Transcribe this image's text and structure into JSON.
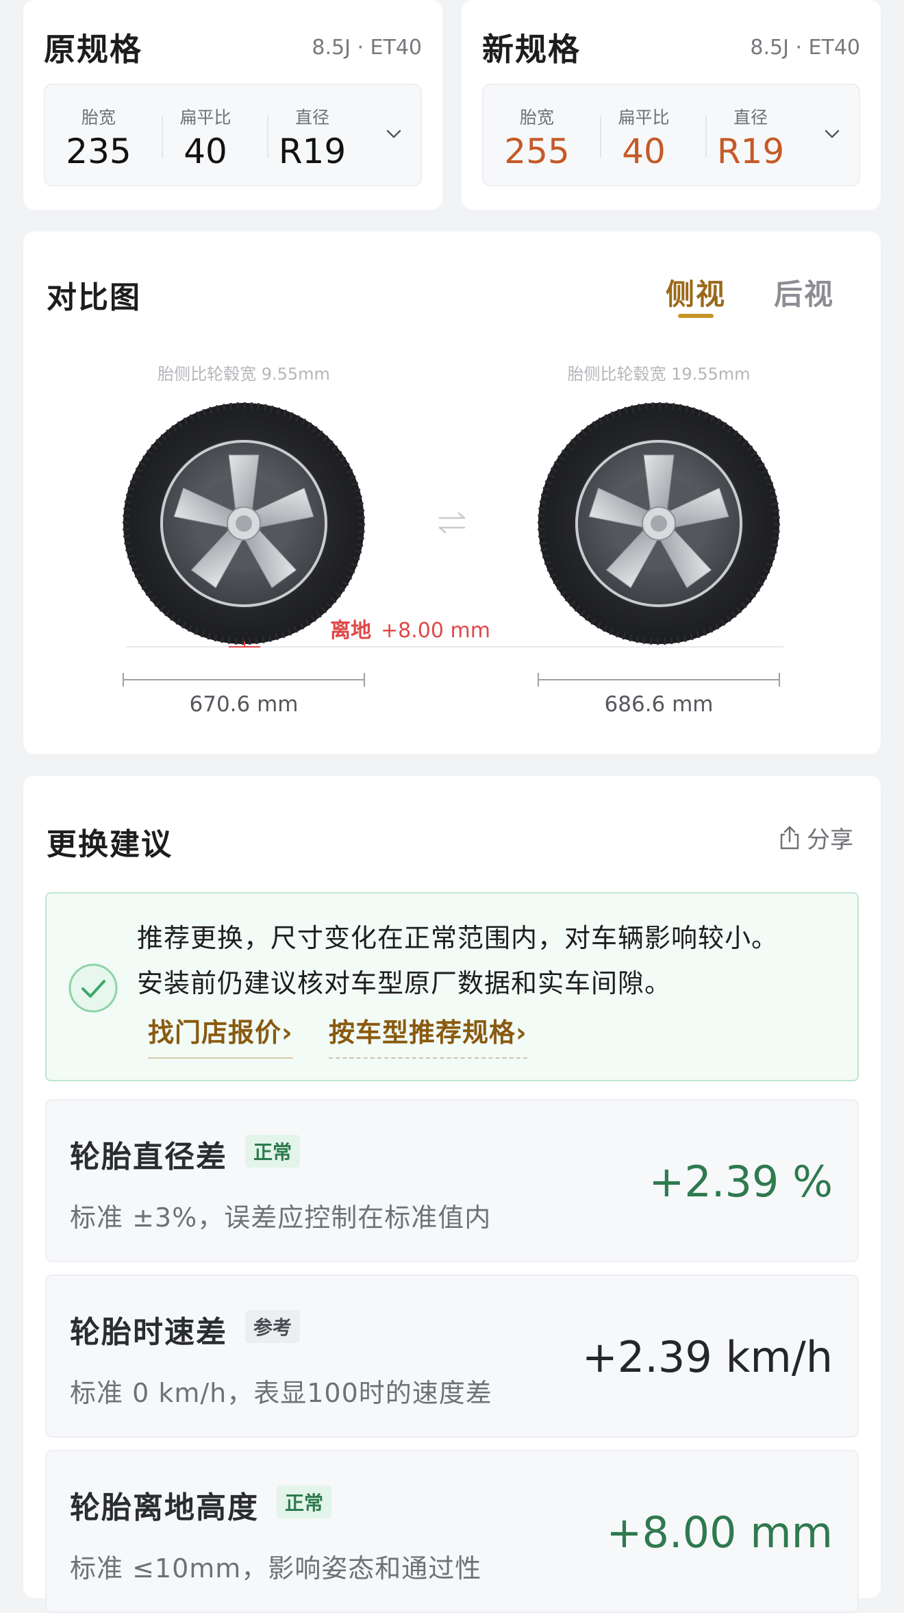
{
  "original": {
    "title": "原规格",
    "hub": "8.5J · ET40",
    "fields": [
      {
        "label": "胎宽",
        "value": "235"
      },
      {
        "label": "扁平比",
        "value": "40"
      },
      {
        "label": "直径",
        "value": "R19"
      }
    ]
  },
  "new": {
    "title": "新规格",
    "hub": "8.5J · ET40",
    "fields": [
      {
        "label": "胎宽",
        "value": "255"
      },
      {
        "label": "扁平比",
        "value": "40"
      },
      {
        "label": "直径",
        "value": "R19"
      }
    ]
  },
  "compare": {
    "title": "对比图",
    "tabs": [
      {
        "label": "侧视",
        "active": true
      },
      {
        "label": "后视",
        "active": false
      }
    ],
    "left_note": "胎侧比轮毂宽 9.55mm",
    "right_note": "胎侧比轮毂宽 19.55mm",
    "ground_label_prefix": "离地",
    "ground_label_value": "+8.00 mm",
    "left_diameter": "670.6 mm",
    "right_diameter": "686.6 mm",
    "accent_color": "#e04848"
  },
  "advice": {
    "title": "更换建议",
    "share_label": "分享",
    "notice_line1": "推荐更换，尺寸变化在正常范围内，对车辆影响较小。",
    "notice_line2": "安装前仍建议核对车型原厂数据和实车间隙。",
    "link1": "找门店报价›",
    "link2": "按车型推荐规格›",
    "metrics": [
      {
        "name": "轮胎直径差",
        "badge": "正常",
        "desc": "标准 ±3%，误差应控制在标准值内",
        "value": "+2.39 %"
      },
      {
        "name": "轮胎时速差",
        "badge": "参考",
        "desc": "标准 0 km/h，表显100时的速度差",
        "value": "+2.39 km/h"
      },
      {
        "name": "轮胎离地高度",
        "badge": "正常",
        "desc": "标准 ≤10mm，影响姿态和通过性",
        "value": "+8.00 mm"
      }
    ]
  }
}
